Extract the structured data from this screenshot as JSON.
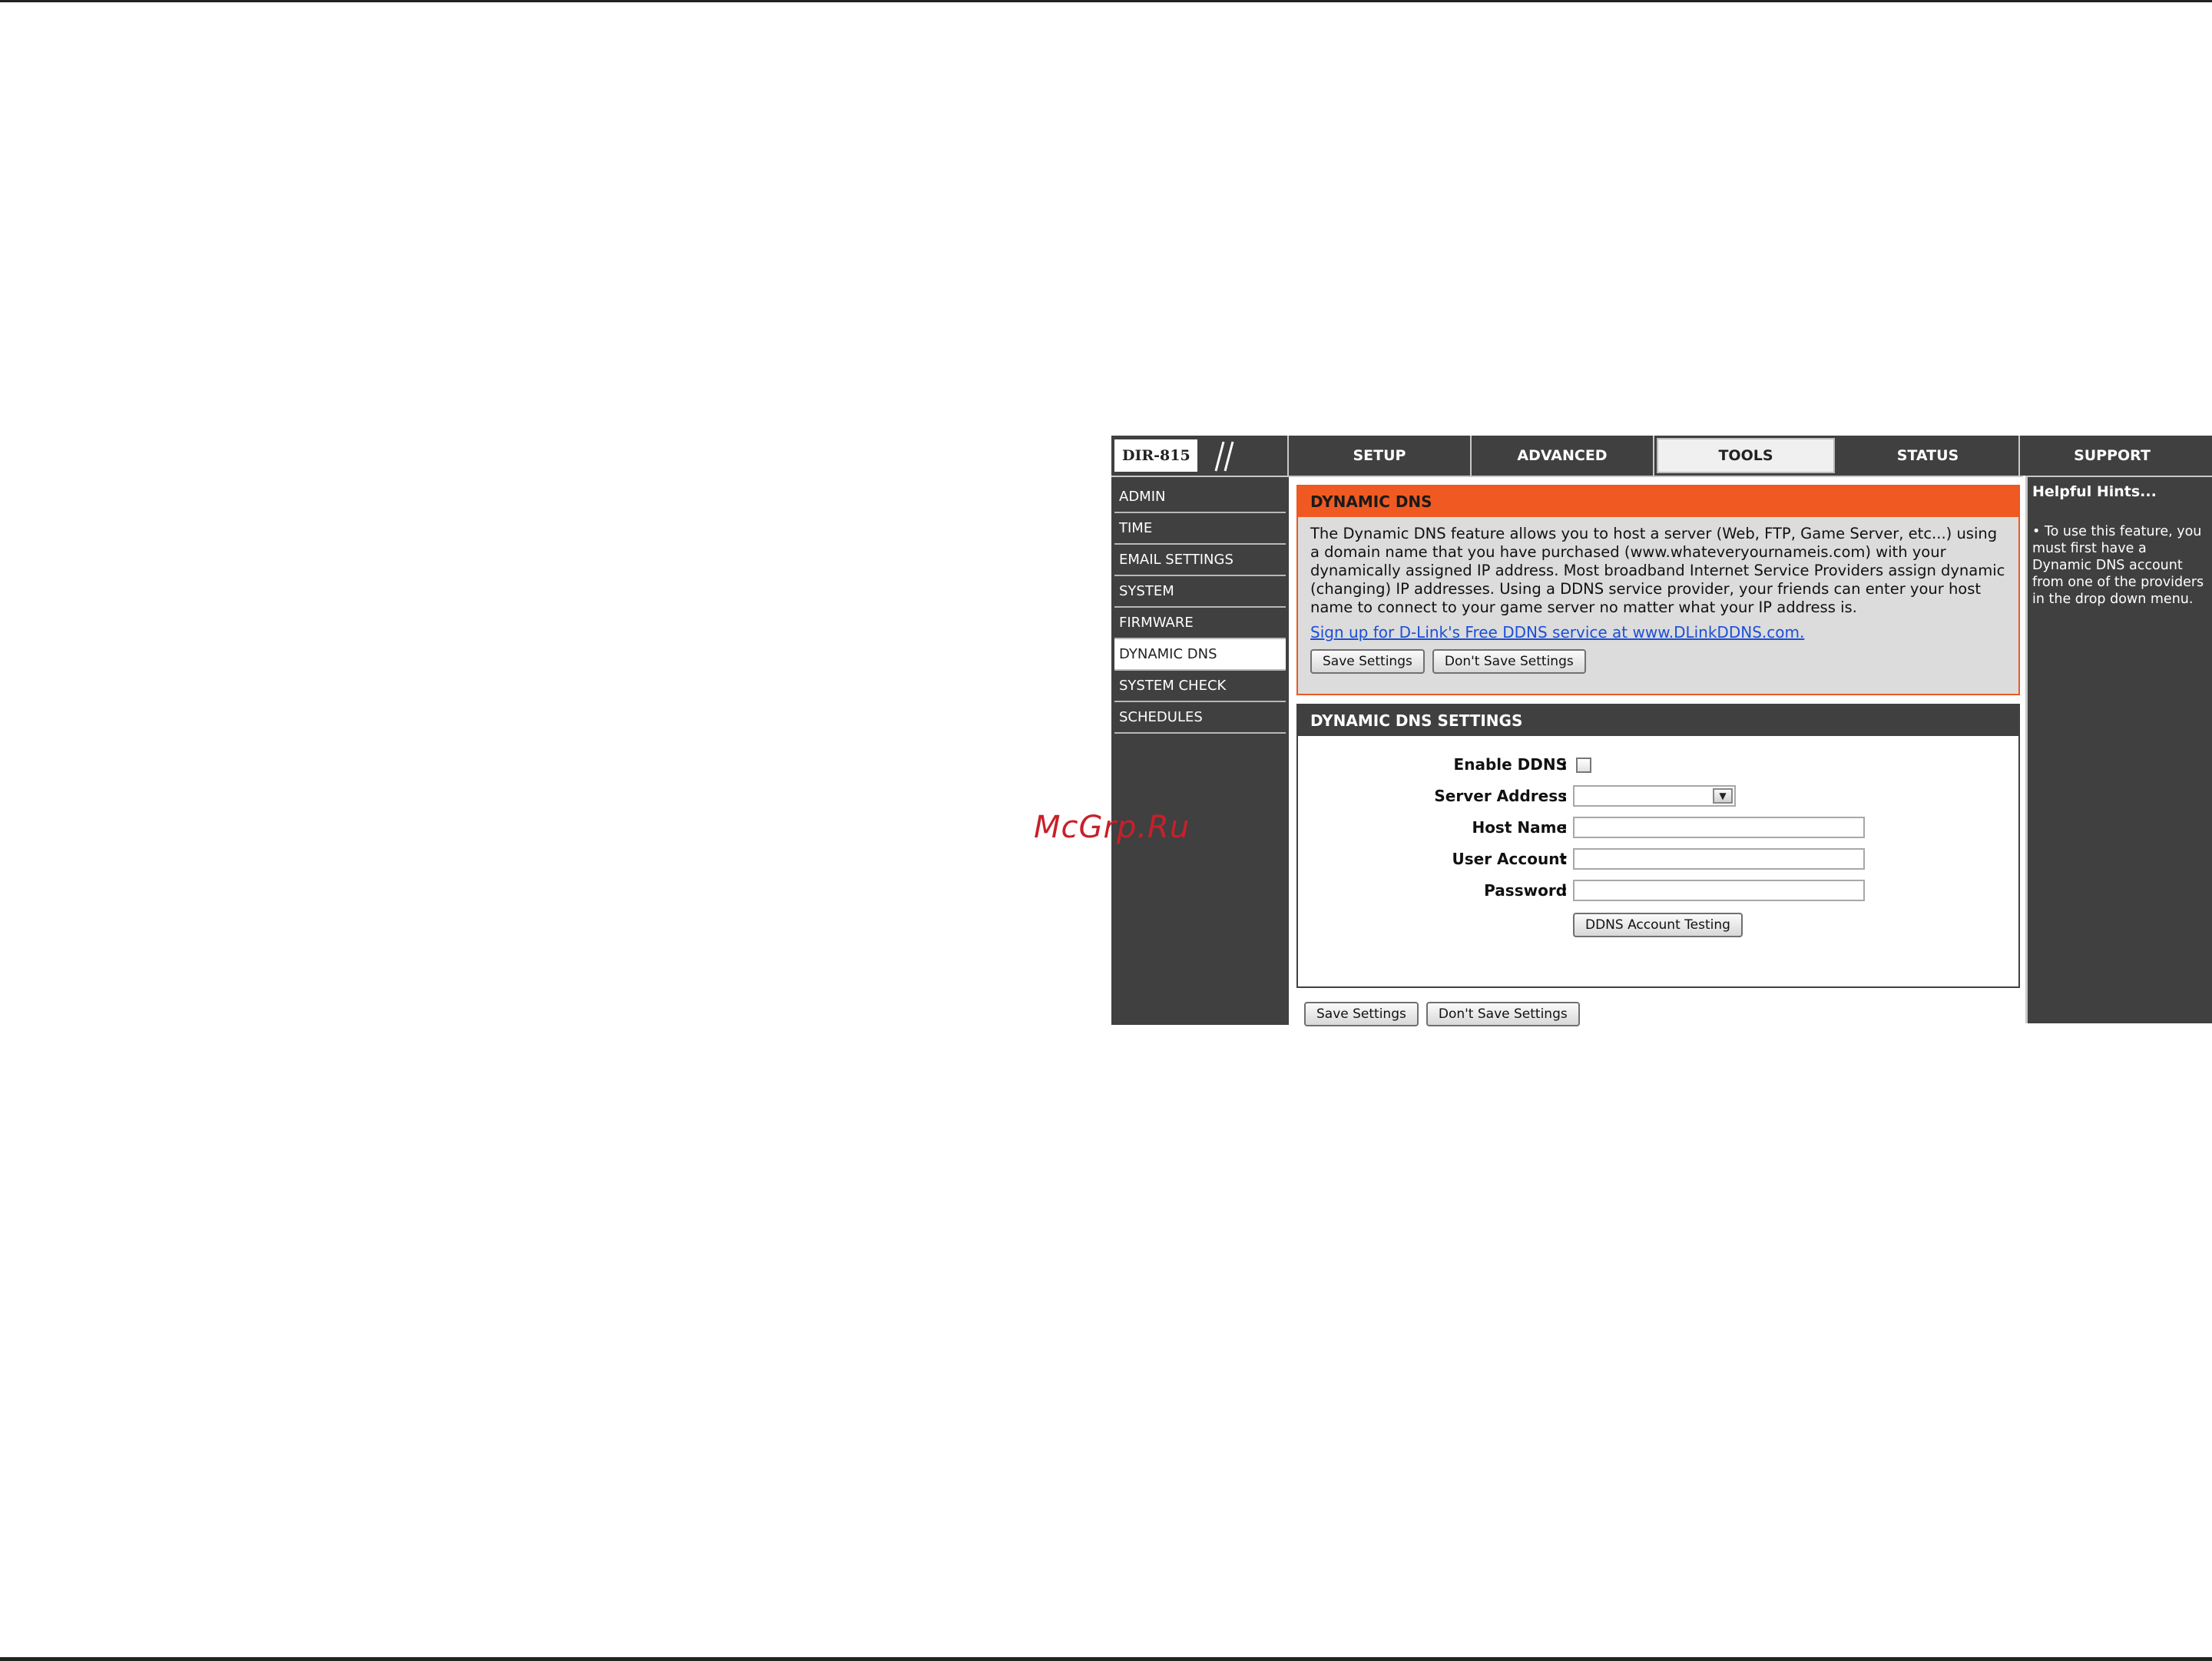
{
  "watermark": "McGrp.Ru",
  "logo": {
    "model": "DIR-815"
  },
  "tabs": [
    {
      "label": "SETUP",
      "active": false
    },
    {
      "label": "ADVANCED",
      "active": false
    },
    {
      "label": "TOOLS",
      "active": true
    },
    {
      "label": "STATUS",
      "active": false
    },
    {
      "label": "SUPPORT",
      "active": false
    }
  ],
  "sidebar": {
    "items": [
      {
        "label": "ADMIN"
      },
      {
        "label": "TIME"
      },
      {
        "label": "EMAIL SETTINGS"
      },
      {
        "label": "SYSTEM"
      },
      {
        "label": "FIRMWARE"
      },
      {
        "label": "DYNAMIC DNS",
        "active": true
      },
      {
        "label": "SYSTEM CHECK"
      },
      {
        "label": "SCHEDULES"
      }
    ]
  },
  "dynamic_dns": {
    "title": "DYNAMIC DNS",
    "description": "The Dynamic DNS feature allows you to host a server (Web, FTP, Game Server, etc...) using a domain name that you have purchased (www.whateveryournameis.com) with your dynamically assigned IP address. Most broadband Internet Service Providers assign dynamic (changing) IP addresses. Using a DDNS service provider, your friends can enter your host name to connect to your game server no matter what your IP address is.",
    "link": "Sign up for D-Link's Free DDNS service at www.DLinkDDNS.com.",
    "save_label": "Save Settings",
    "dont_save_label": "Don't Save Settings"
  },
  "settings": {
    "title": "DYNAMIC DNS SETTINGS",
    "enable_ddns_label": "Enable DDNS",
    "enable_ddns_checked": false,
    "server_address_label": "Server Address",
    "server_address_value": "",
    "host_name_label": "Host Name",
    "host_name_value": "",
    "user_account_label": "User Account",
    "user_account_value": "",
    "password_label": "Password",
    "password_value": "",
    "colon": ":",
    "test_button_label": "DDNS Account Testing"
  },
  "bottom": {
    "save_label": "Save Settings",
    "dont_save_label": "Don't Save Settings"
  },
  "hints": {
    "title": "Helpful Hints...",
    "text": "• To use this feature, you must first have a Dynamic DNS account from one of the providers in the drop down menu."
  },
  "colors": {
    "dark_gray": "#404040",
    "orange_header": "#f05a22",
    "link_blue": "#1c4fd8",
    "watermark_red": "#c8202a"
  }
}
